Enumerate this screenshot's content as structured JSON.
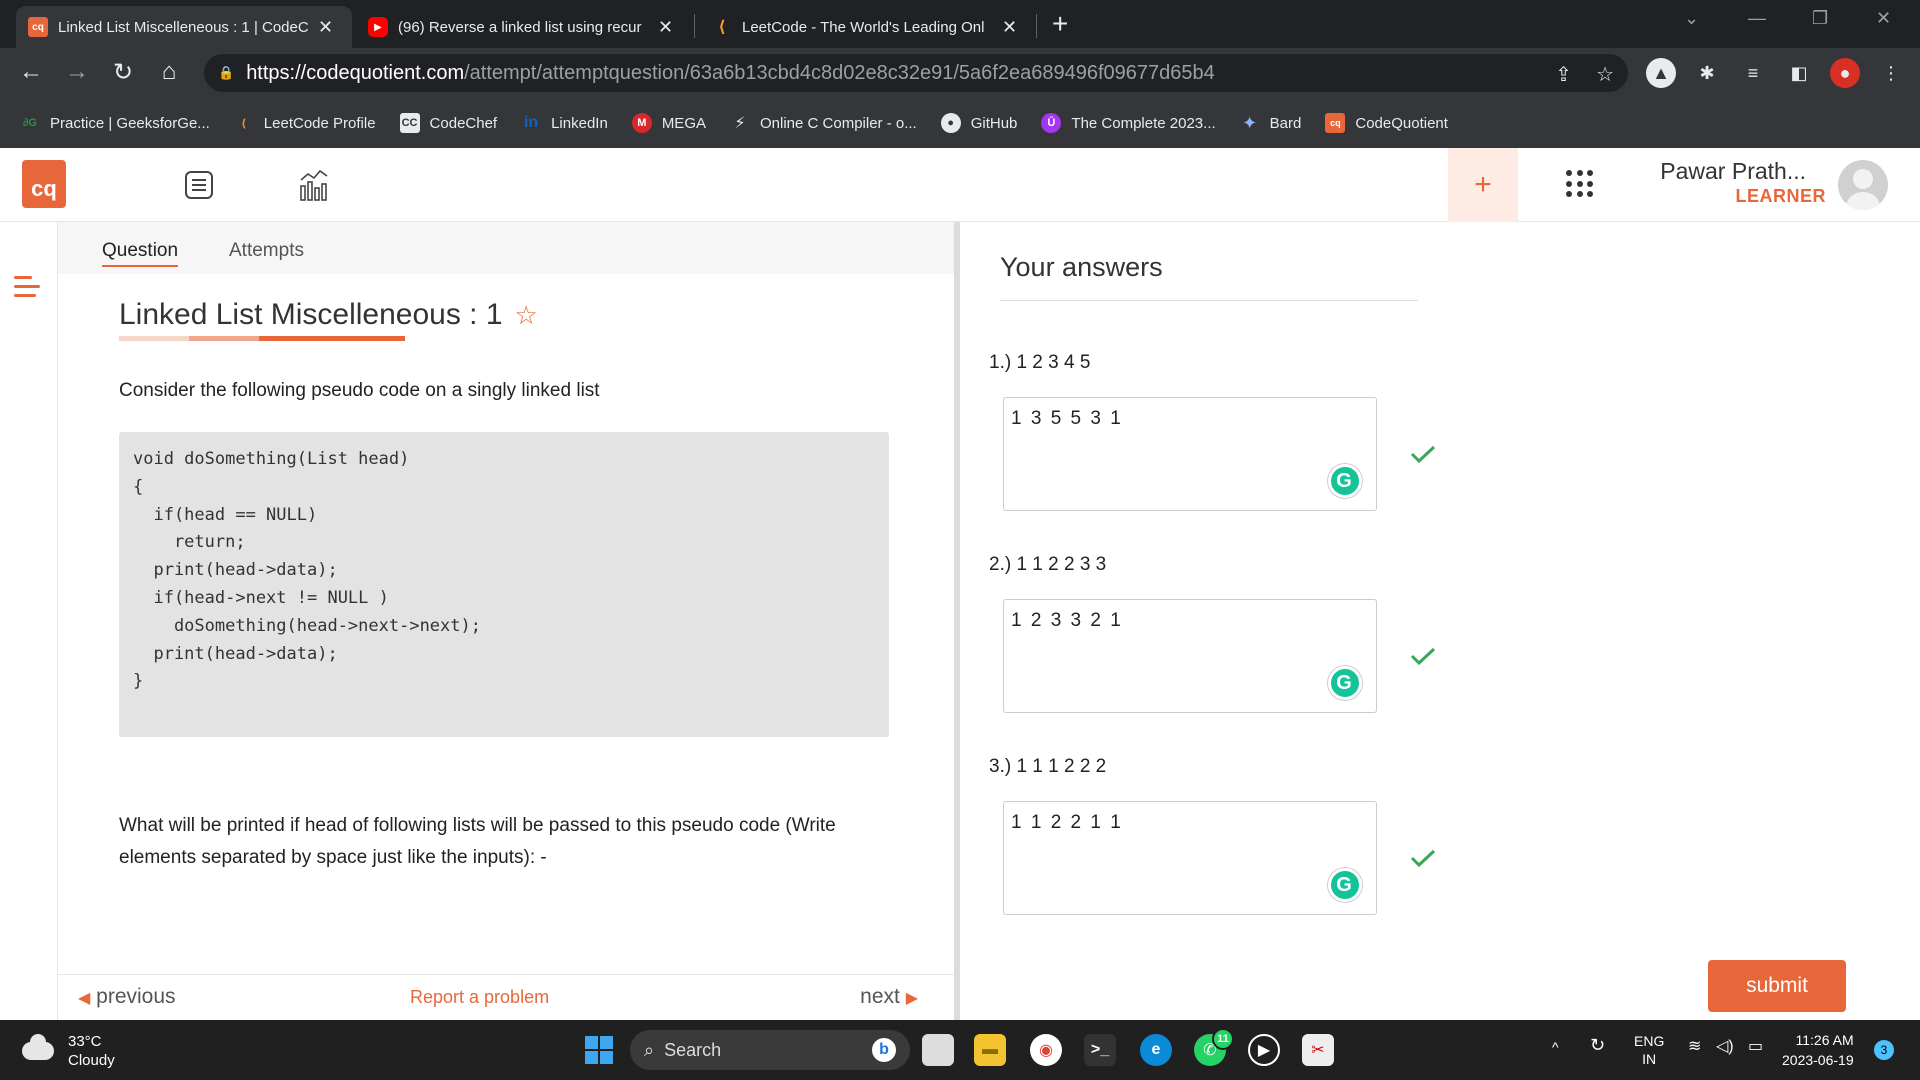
{
  "browser": {
    "tabs": [
      {
        "title": "Linked List Miscelleneous : 1 | CodeC",
        "favicon": "cq",
        "active": true
      },
      {
        "title": "(96) Reverse a linked list using recur",
        "favicon": "youtube-icon",
        "active": false
      },
      {
        "title": "LeetCode - The World's Leading Onl",
        "favicon": "leetcode-icon",
        "active": false
      }
    ],
    "url_host": "https://codequotient.com",
    "url_path": "/attempt/attemptquestion/63a6b13cbd4c8d02e8c32e91/5a6f2ea689496f09677d65b4",
    "bookmarks": [
      {
        "label": "Practice | GeeksforGe...",
        "icon": "gfg-icon"
      },
      {
        "label": "LeetCode Profile",
        "icon": "leetcode-icon"
      },
      {
        "label": "CodeChef",
        "icon": "codechef-icon"
      },
      {
        "label": "LinkedIn",
        "icon": "linkedin-icon"
      },
      {
        "label": "MEGA",
        "icon": "mega-icon"
      },
      {
        "label": "Online C Compiler - o...",
        "icon": "bolt-icon"
      },
      {
        "label": "GitHub",
        "icon": "github-icon"
      },
      {
        "label": "The Complete 2023...",
        "icon": "udemy-icon"
      },
      {
        "label": "Bard",
        "icon": "bard-icon"
      },
      {
        "label": "CodeQuotient",
        "icon": "cq"
      }
    ]
  },
  "app": {
    "logo_text": "cq",
    "user_name": "Pawar Prath...",
    "user_role": "LEARNER",
    "plus": "+"
  },
  "question": {
    "tabs": [
      "Question",
      "Attempts"
    ],
    "title": "Linked List Miscelleneous : 1",
    "intro": "Consider the following pseudo code on a singly linked list",
    "code_lines": [
      "void doSomething(List head)",
      "{",
      "  if(head == NULL)",
      "    return;",
      "  print(head->data);",
      "",
      "  if(head->next != NULL )",
      "    doSomething(head->next->next);",
      "  print(head->data);",
      "}"
    ],
    "prompt": "What will be printed if head of following lists will be passed to this pseudo code (Write elements separated by space just like the inputs): -",
    "footer": {
      "previous": "previous",
      "report": "Report a problem",
      "next": "next"
    }
  },
  "answers": {
    "heading": "Your answers",
    "items": [
      {
        "label": "1.) 1 2 3 4 5",
        "value": "1 3 5 5 3 1",
        "correct": true
      },
      {
        "label": "2.) 1 1 2 2 3 3",
        "value": "1 2 3 3 2 1",
        "correct": true
      },
      {
        "label": "3.) 1 1 1 2 2 2",
        "value": "1 1 2 2 1 1",
        "correct": true
      }
    ],
    "submit": "submit"
  },
  "taskbar": {
    "temp": "33°C",
    "weather": "Cloudy",
    "search": "Search",
    "whatsapp_badge": "11",
    "lang1": "ENG",
    "lang2": "IN",
    "time": "11:26 AM",
    "date": "2023-06-19",
    "notifications": "3"
  },
  "colors": {
    "accent": "#e8673a",
    "success": "#3aa757",
    "grammarly": "#15c39a"
  }
}
